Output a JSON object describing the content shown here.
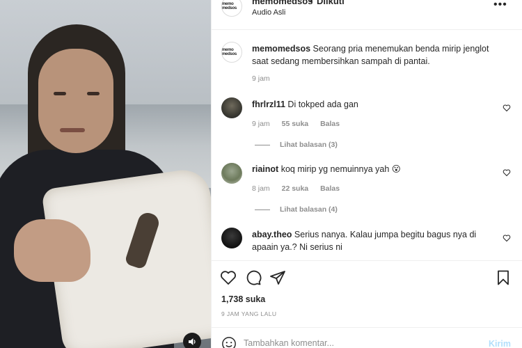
{
  "header": {
    "username": "memomedsos",
    "separator": "•",
    "follow_state": "Diikuti",
    "audio": "Audio Asli",
    "more_icon": "more-horizontal-icon",
    "avatar_text": "memo medsos"
  },
  "caption": {
    "username": "memomedsos",
    "text": "Seorang pria menemukan benda mirip jenglot saat sedang membersihkan sampah di pantai.",
    "time": "9 jam"
  },
  "comments": [
    {
      "username": "fhrlrzl11",
      "text": "Di tokped ada gan",
      "time": "9 jam",
      "likes": "55 suka",
      "reply": "Balas",
      "view_replies": "Lihat balasan (3)"
    },
    {
      "username": "riainot",
      "text": "koq mirip yg nemuinnya yah 😮",
      "time": "8 jam",
      "likes": "22 suka",
      "reply": "Balas",
      "view_replies": "Lihat balasan (4)"
    },
    {
      "username": "abay.theo",
      "text": "Serius nanya. Kalau jumpa begitu bagus nya di apaain ya.? Ni serius ni"
    }
  ],
  "stats": {
    "likes": "1,738 suka",
    "posted": "9 JAM YANG LALU"
  },
  "add_comment": {
    "placeholder": "Tambahkan komentar...",
    "post_label": "Kirim"
  },
  "colors": {
    "text": "#262626",
    "muted": "#8e8e8e",
    "border": "#efefef",
    "post_disabled": "#b2dffc"
  }
}
